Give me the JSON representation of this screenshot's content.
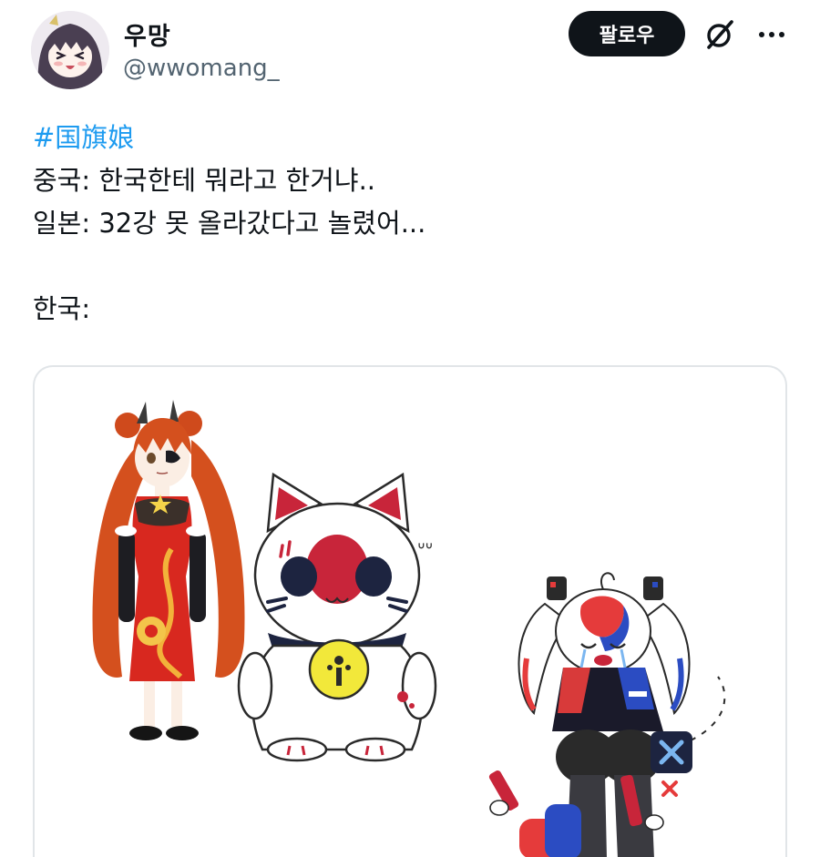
{
  "author": {
    "display_name": "우망",
    "handle": "@wwomang_",
    "avatar_icon": "avatar-icon"
  },
  "actions": {
    "follow_label": "팔로우",
    "grok_icon": "grok-icon",
    "more_icon": "more-icon"
  },
  "tweet": {
    "hashtag": "#国旗娘",
    "line1": "중국: 한국한테 뭐라고 한거냐..",
    "line2": "일본: 32강 못 올라갔다고 놀렸어...",
    "line3": "",
    "line4": "한국:"
  },
  "media": {
    "type": "illustration",
    "annotation_text": "ᐡᐡ"
  },
  "colors": {
    "accent": "#1d9bf0",
    "button_bg": "#0f1419",
    "secondary_text": "#536471",
    "border": "#e1e5e8"
  }
}
